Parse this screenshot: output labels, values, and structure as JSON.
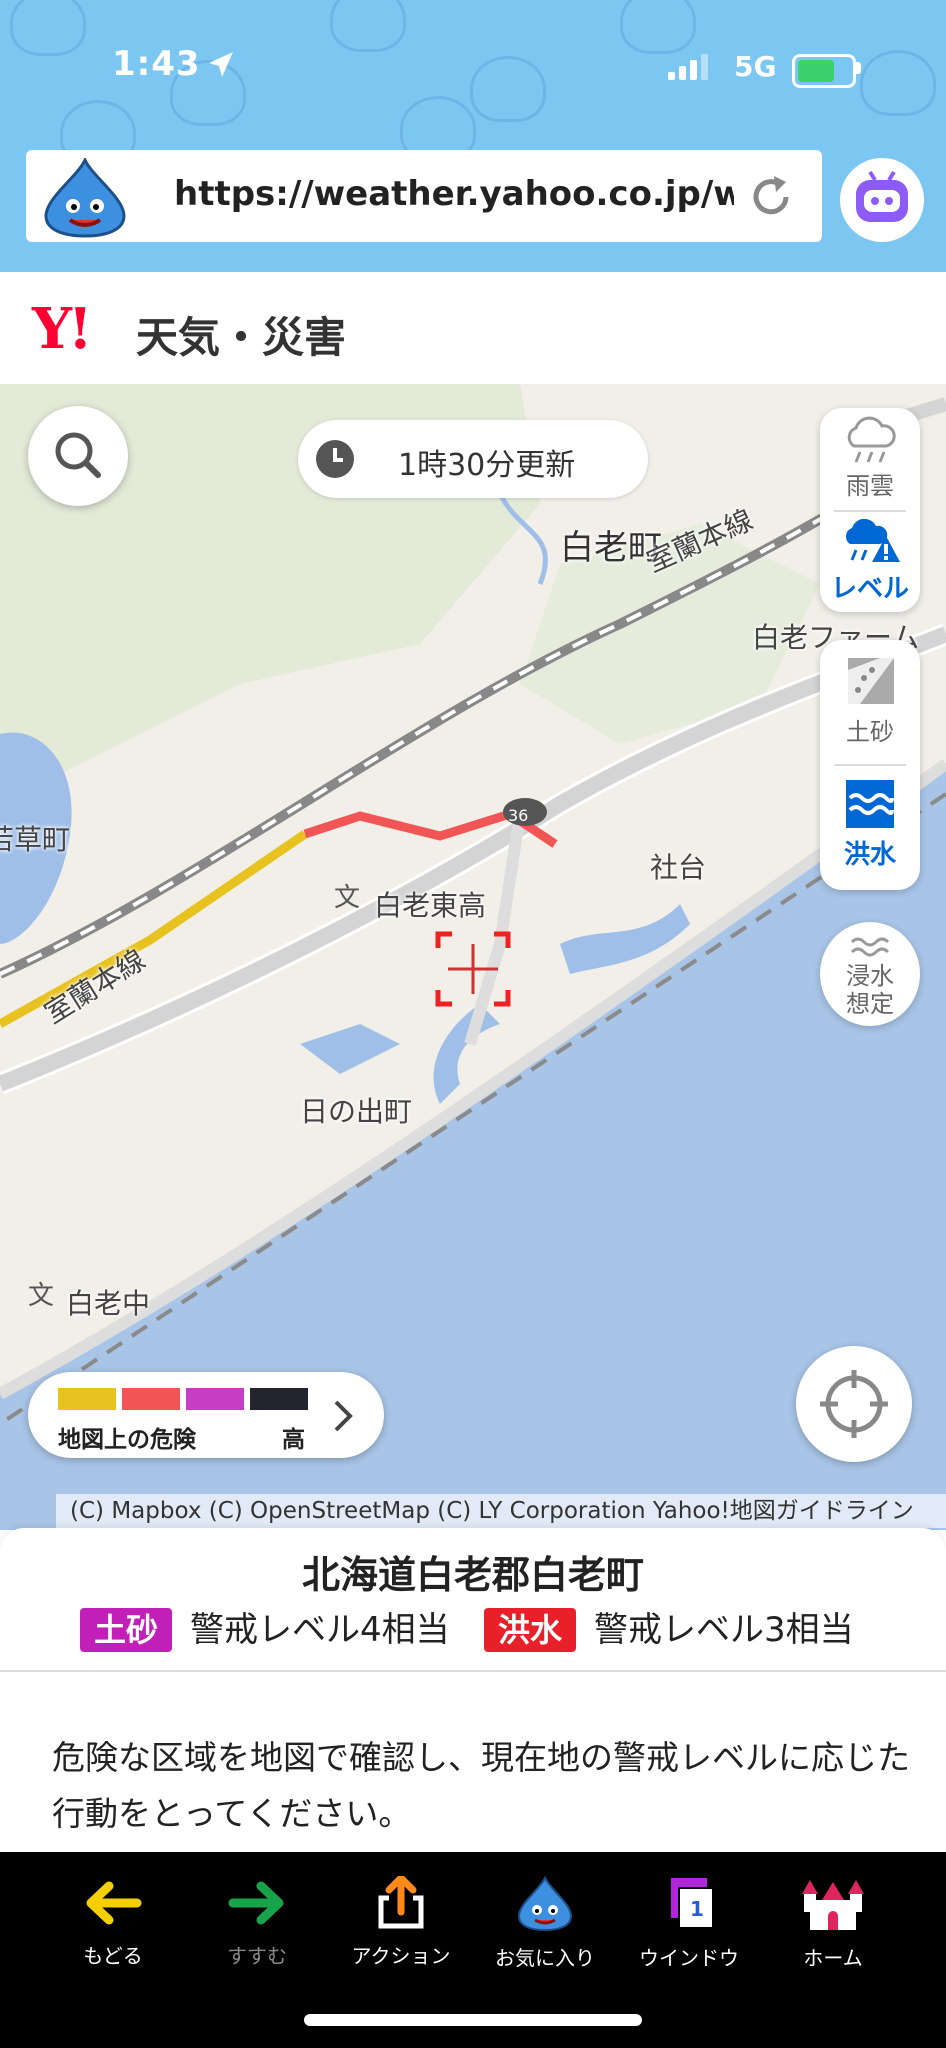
{
  "status_bar": {
    "time": "1:43",
    "network": "5G"
  },
  "browser": {
    "url": "https://weather.yahoo.co.jp/we..."
  },
  "header": {
    "logo": "Y!",
    "title": "天気・災害"
  },
  "map": {
    "update_text": "1時30分更新",
    "labels": {
      "shiraoi_town": "白老町",
      "muroran_line_ne": "室蘭本線",
      "shiraoi_farm": "白老ファーム",
      "wakakusa": "若草町",
      "shadai": "社台",
      "school_east": "白老東高",
      "muroran_line_sw": "室蘭本線",
      "hinode": "日の出町",
      "school_mid": "白老中",
      "route_no": "36"
    },
    "layers": {
      "rain": "雨雲",
      "level": "レベル",
      "landslide": "土砂",
      "flood": "洪水",
      "inundation_line1": "浸水",
      "inundation_line2": "想定"
    },
    "legend": {
      "label": "地図上の危険",
      "high": "高",
      "colors": [
        "#e8c21e",
        "#f25555",
        "#c63ec4",
        "#24242e"
      ]
    },
    "attribution": "(C) Mapbox (C) OpenStreetMap (C) LY Corporation Yahoo!地図ガイドライン"
  },
  "panel": {
    "place": "北海道白老郡白老町",
    "landslide_badge": "土砂",
    "landslide_level": "警戒レベル4相当",
    "flood_badge": "洪水",
    "flood_level": "警戒レベル3相当",
    "message": "危険な区域を地図で確認し、現在地の警戒レベルに応じた行動をとってください。"
  },
  "toolbar": {
    "back": "もどる",
    "forward": "すすむ",
    "action": "アクション",
    "favorites": "お気に入り",
    "window": "ウインドウ",
    "window_count": "1",
    "home": "ホーム"
  },
  "colors": {
    "sky": "#7cc7f2",
    "yahoo_red": "#ff0033",
    "active_blue": "#0068d4",
    "landslide_badge": "#c21fb8",
    "flood_badge": "#e8202a",
    "sea": "#a8c4e6"
  }
}
